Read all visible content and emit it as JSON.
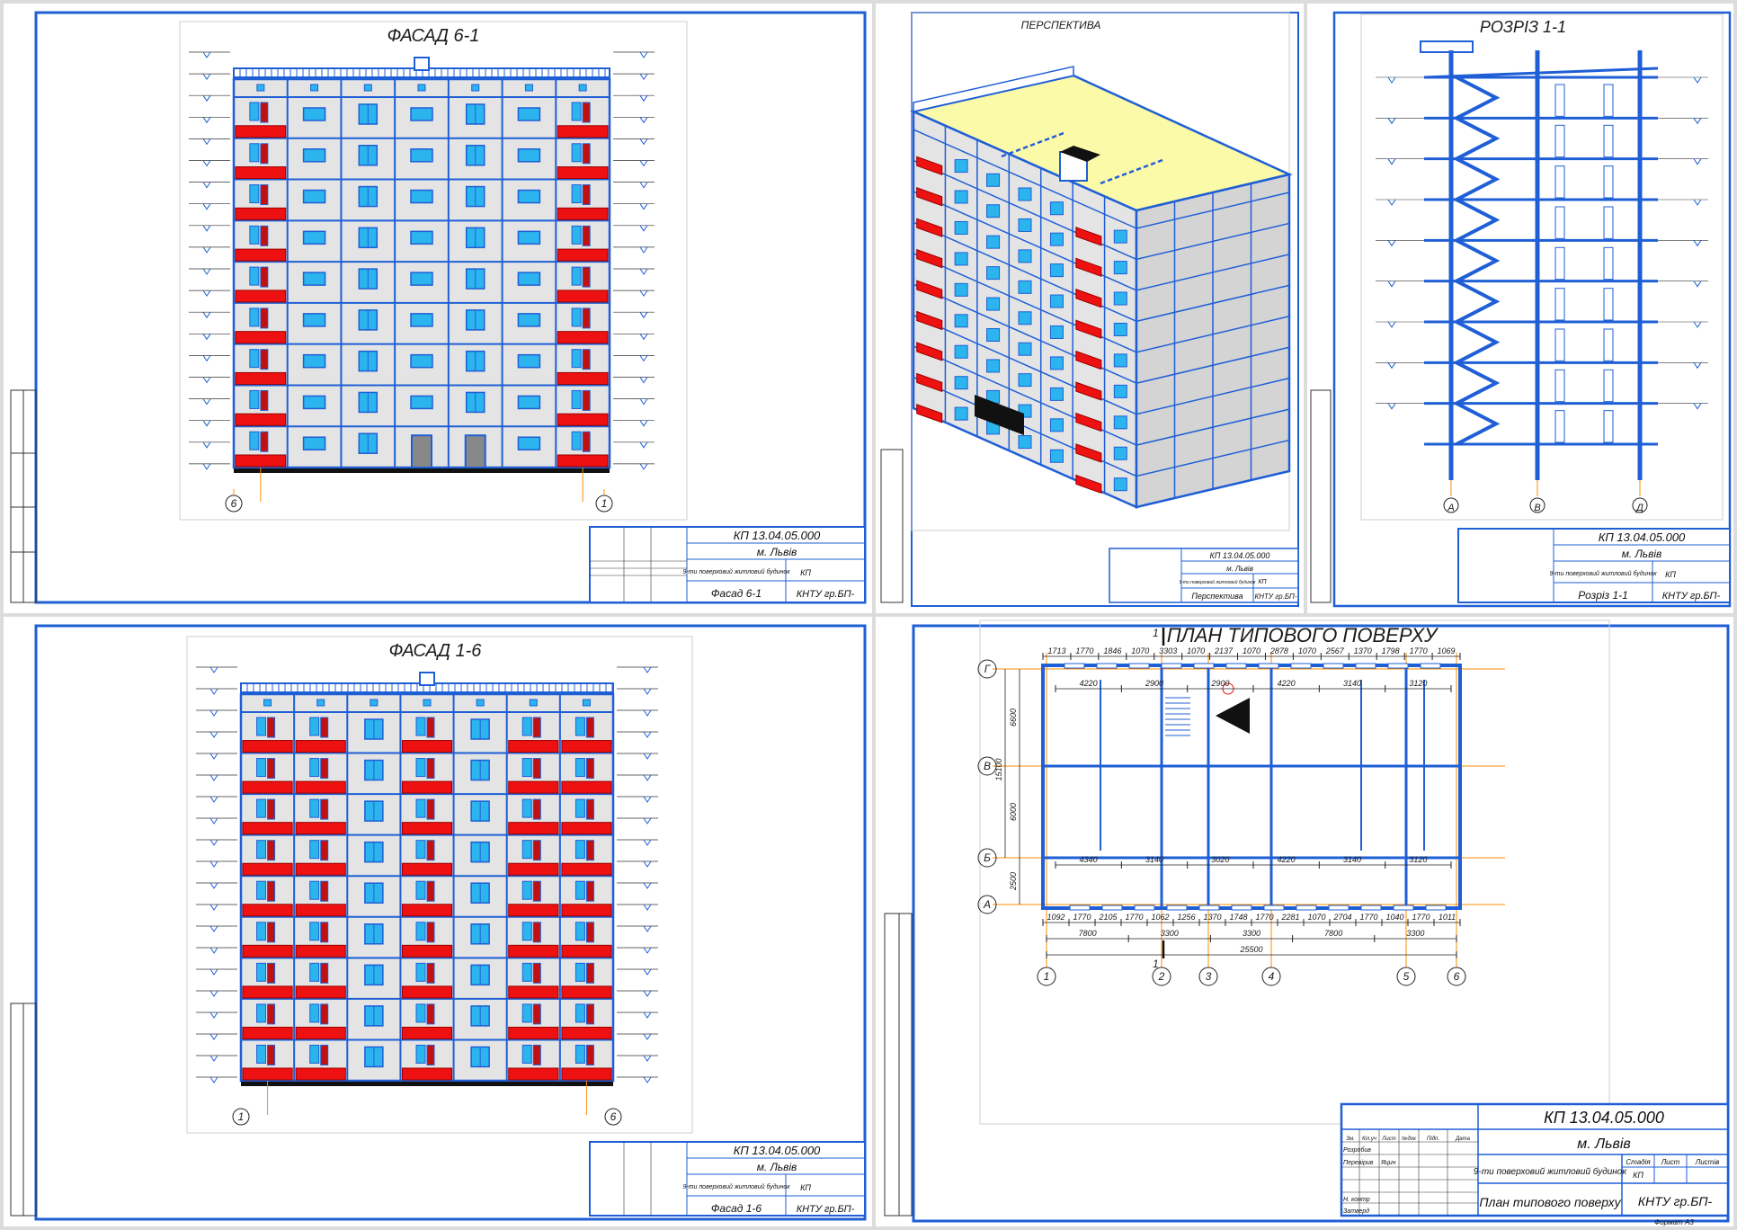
{
  "colors": {
    "frame": "#1f5fd6",
    "window": "#2bb4ee",
    "balcony": "#ee1111",
    "wall": "#e4e4e4",
    "roof": "#fbfaa8",
    "axis": "#ff8c00",
    "ink": "#1a1a1a"
  },
  "sheets": {
    "facade61": {
      "title": "ФАСАД 6-1",
      "axis_left": "6",
      "axis_right": "1",
      "stamp": {
        "code": "КП 13.04.05.000",
        "city": "м. Львів",
        "building": "9-ти поверховий житловий будинок",
        "sheet_title": "Фасад 6-1",
        "org": "КНТУ гр.БП-",
        "stage": "КП"
      }
    },
    "perspective": {
      "title": "ПЕРСПЕКТИВА",
      "stamp": {
        "code": "КП 13.04.05.000",
        "city": "м. Львів",
        "building": "9-ти поверховий житловий будинок",
        "sheet_title": "Перспектива",
        "org": "КНТУ гр.БП-",
        "stage": "КП"
      }
    },
    "section": {
      "title": "РОЗРІЗ 1-1",
      "axes": [
        "А",
        "В",
        "Д"
      ],
      "stamp": {
        "code": "КП 13.04.05.000",
        "city": "м. Львів",
        "building": "9-ти поверховий житловий будинок",
        "sheet_title": "Розріз 1-1",
        "org": "КНТУ гр.БП-",
        "stage": "КП"
      }
    },
    "facade16": {
      "title": "ФАСАД 1-6",
      "axis_left": "1",
      "axis_right": "6",
      "stamp": {
        "code": "КП 13.04.05.000",
        "city": "м. Львів",
        "building": "9-ти поверховий житловий будинок",
        "sheet_title": "Фасад 1-6",
        "org": "КНТУ гр.БП-",
        "stage": "КП"
      }
    },
    "plan": {
      "title": "ПЛАН ТИПОВОГО ПОВЕРХУ",
      "cut_mark": "1",
      "row_axes": [
        "Г",
        "В",
        "Б",
        "А"
      ],
      "col_axes": [
        "1",
        "2",
        "3",
        "4",
        "5",
        "6"
      ],
      "top_dims": [
        "1713",
        "1770",
        "1846",
        "1070",
        "3303",
        "1070",
        "2137",
        "1070",
        "2878",
        "1070",
        "2567",
        "1370",
        "1798",
        "1770",
        "1069"
      ],
      "bottom_dims": [
        "1092",
        "1770",
        "2105",
        "1770",
        "1062",
        "1256",
        "1370",
        "1748",
        "1770",
        "2281",
        "1070",
        "2704",
        "1770",
        "1040",
        "1770",
        "1011"
      ],
      "bays": [
        "7800",
        "3300",
        "3300",
        "7800",
        "3300"
      ],
      "total": "25500",
      "left_dims": [
        "6600",
        "6000",
        "2500"
      ],
      "left_total": "15100",
      "room_dims": [
        "4220",
        "2900",
        "2900",
        "4220",
        "3140",
        "3120",
        "4340",
        "3140",
        "3020",
        "4220",
        "3140",
        "3120"
      ],
      "stamp": {
        "code": "КП 13.04.05.000",
        "city": "м. Львів",
        "building": "9-ти поверховий житловий будинок",
        "sheet_title": "План типового поверху",
        "org": "КНТУ гр.БП-",
        "stage_h": "Стадія",
        "sheet_h": "Лист",
        "sheets_h": "Листів",
        "stage": "КП",
        "developed": "Розробив",
        "checked": "Перевірив",
        "checker": "Яцин",
        "nkontr": "Н. контр",
        "approved": "Затверд",
        "cols": [
          "Зм.",
          "Кіл.уч",
          "Лист",
          "№док",
          "Підп.",
          "Дата"
        ],
        "format": "Формат  А3"
      }
    }
  }
}
